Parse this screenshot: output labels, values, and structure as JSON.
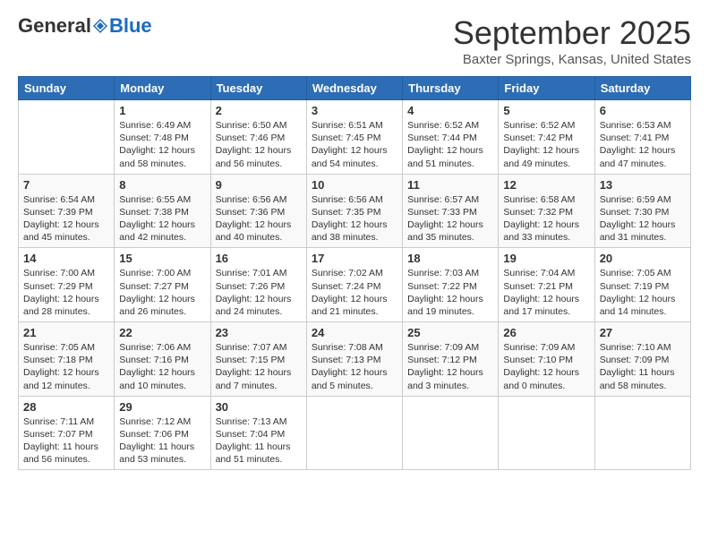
{
  "logo": {
    "general": "General",
    "blue": "Blue"
  },
  "header": {
    "title": "September 2025",
    "location": "Baxter Springs, Kansas, United States"
  },
  "weekdays": [
    "Sunday",
    "Monday",
    "Tuesday",
    "Wednesday",
    "Thursday",
    "Friday",
    "Saturday"
  ],
  "weeks": [
    [
      {
        "day": "",
        "info": ""
      },
      {
        "day": "1",
        "info": "Sunrise: 6:49 AM\nSunset: 7:48 PM\nDaylight: 12 hours\nand 58 minutes."
      },
      {
        "day": "2",
        "info": "Sunrise: 6:50 AM\nSunset: 7:46 PM\nDaylight: 12 hours\nand 56 minutes."
      },
      {
        "day": "3",
        "info": "Sunrise: 6:51 AM\nSunset: 7:45 PM\nDaylight: 12 hours\nand 54 minutes."
      },
      {
        "day": "4",
        "info": "Sunrise: 6:52 AM\nSunset: 7:44 PM\nDaylight: 12 hours\nand 51 minutes."
      },
      {
        "day": "5",
        "info": "Sunrise: 6:52 AM\nSunset: 7:42 PM\nDaylight: 12 hours\nand 49 minutes."
      },
      {
        "day": "6",
        "info": "Sunrise: 6:53 AM\nSunset: 7:41 PM\nDaylight: 12 hours\nand 47 minutes."
      }
    ],
    [
      {
        "day": "7",
        "info": "Sunrise: 6:54 AM\nSunset: 7:39 PM\nDaylight: 12 hours\nand 45 minutes."
      },
      {
        "day": "8",
        "info": "Sunrise: 6:55 AM\nSunset: 7:38 PM\nDaylight: 12 hours\nand 42 minutes."
      },
      {
        "day": "9",
        "info": "Sunrise: 6:56 AM\nSunset: 7:36 PM\nDaylight: 12 hours\nand 40 minutes."
      },
      {
        "day": "10",
        "info": "Sunrise: 6:56 AM\nSunset: 7:35 PM\nDaylight: 12 hours\nand 38 minutes."
      },
      {
        "day": "11",
        "info": "Sunrise: 6:57 AM\nSunset: 7:33 PM\nDaylight: 12 hours\nand 35 minutes."
      },
      {
        "day": "12",
        "info": "Sunrise: 6:58 AM\nSunset: 7:32 PM\nDaylight: 12 hours\nand 33 minutes."
      },
      {
        "day": "13",
        "info": "Sunrise: 6:59 AM\nSunset: 7:30 PM\nDaylight: 12 hours\nand 31 minutes."
      }
    ],
    [
      {
        "day": "14",
        "info": "Sunrise: 7:00 AM\nSunset: 7:29 PM\nDaylight: 12 hours\nand 28 minutes."
      },
      {
        "day": "15",
        "info": "Sunrise: 7:00 AM\nSunset: 7:27 PM\nDaylight: 12 hours\nand 26 minutes."
      },
      {
        "day": "16",
        "info": "Sunrise: 7:01 AM\nSunset: 7:26 PM\nDaylight: 12 hours\nand 24 minutes."
      },
      {
        "day": "17",
        "info": "Sunrise: 7:02 AM\nSunset: 7:24 PM\nDaylight: 12 hours\nand 21 minutes."
      },
      {
        "day": "18",
        "info": "Sunrise: 7:03 AM\nSunset: 7:22 PM\nDaylight: 12 hours\nand 19 minutes."
      },
      {
        "day": "19",
        "info": "Sunrise: 7:04 AM\nSunset: 7:21 PM\nDaylight: 12 hours\nand 17 minutes."
      },
      {
        "day": "20",
        "info": "Sunrise: 7:05 AM\nSunset: 7:19 PM\nDaylight: 12 hours\nand 14 minutes."
      }
    ],
    [
      {
        "day": "21",
        "info": "Sunrise: 7:05 AM\nSunset: 7:18 PM\nDaylight: 12 hours\nand 12 minutes."
      },
      {
        "day": "22",
        "info": "Sunrise: 7:06 AM\nSunset: 7:16 PM\nDaylight: 12 hours\nand 10 minutes."
      },
      {
        "day": "23",
        "info": "Sunrise: 7:07 AM\nSunset: 7:15 PM\nDaylight: 12 hours\nand 7 minutes."
      },
      {
        "day": "24",
        "info": "Sunrise: 7:08 AM\nSunset: 7:13 PM\nDaylight: 12 hours\nand 5 minutes."
      },
      {
        "day": "25",
        "info": "Sunrise: 7:09 AM\nSunset: 7:12 PM\nDaylight: 12 hours\nand 3 minutes."
      },
      {
        "day": "26",
        "info": "Sunrise: 7:09 AM\nSunset: 7:10 PM\nDaylight: 12 hours\nand 0 minutes."
      },
      {
        "day": "27",
        "info": "Sunrise: 7:10 AM\nSunset: 7:09 PM\nDaylight: 11 hours\nand 58 minutes."
      }
    ],
    [
      {
        "day": "28",
        "info": "Sunrise: 7:11 AM\nSunset: 7:07 PM\nDaylight: 11 hours\nand 56 minutes."
      },
      {
        "day": "29",
        "info": "Sunrise: 7:12 AM\nSunset: 7:06 PM\nDaylight: 11 hours\nand 53 minutes."
      },
      {
        "day": "30",
        "info": "Sunrise: 7:13 AM\nSunset: 7:04 PM\nDaylight: 11 hours\nand 51 minutes."
      },
      {
        "day": "",
        "info": ""
      },
      {
        "day": "",
        "info": ""
      },
      {
        "day": "",
        "info": ""
      },
      {
        "day": "",
        "info": ""
      }
    ]
  ]
}
